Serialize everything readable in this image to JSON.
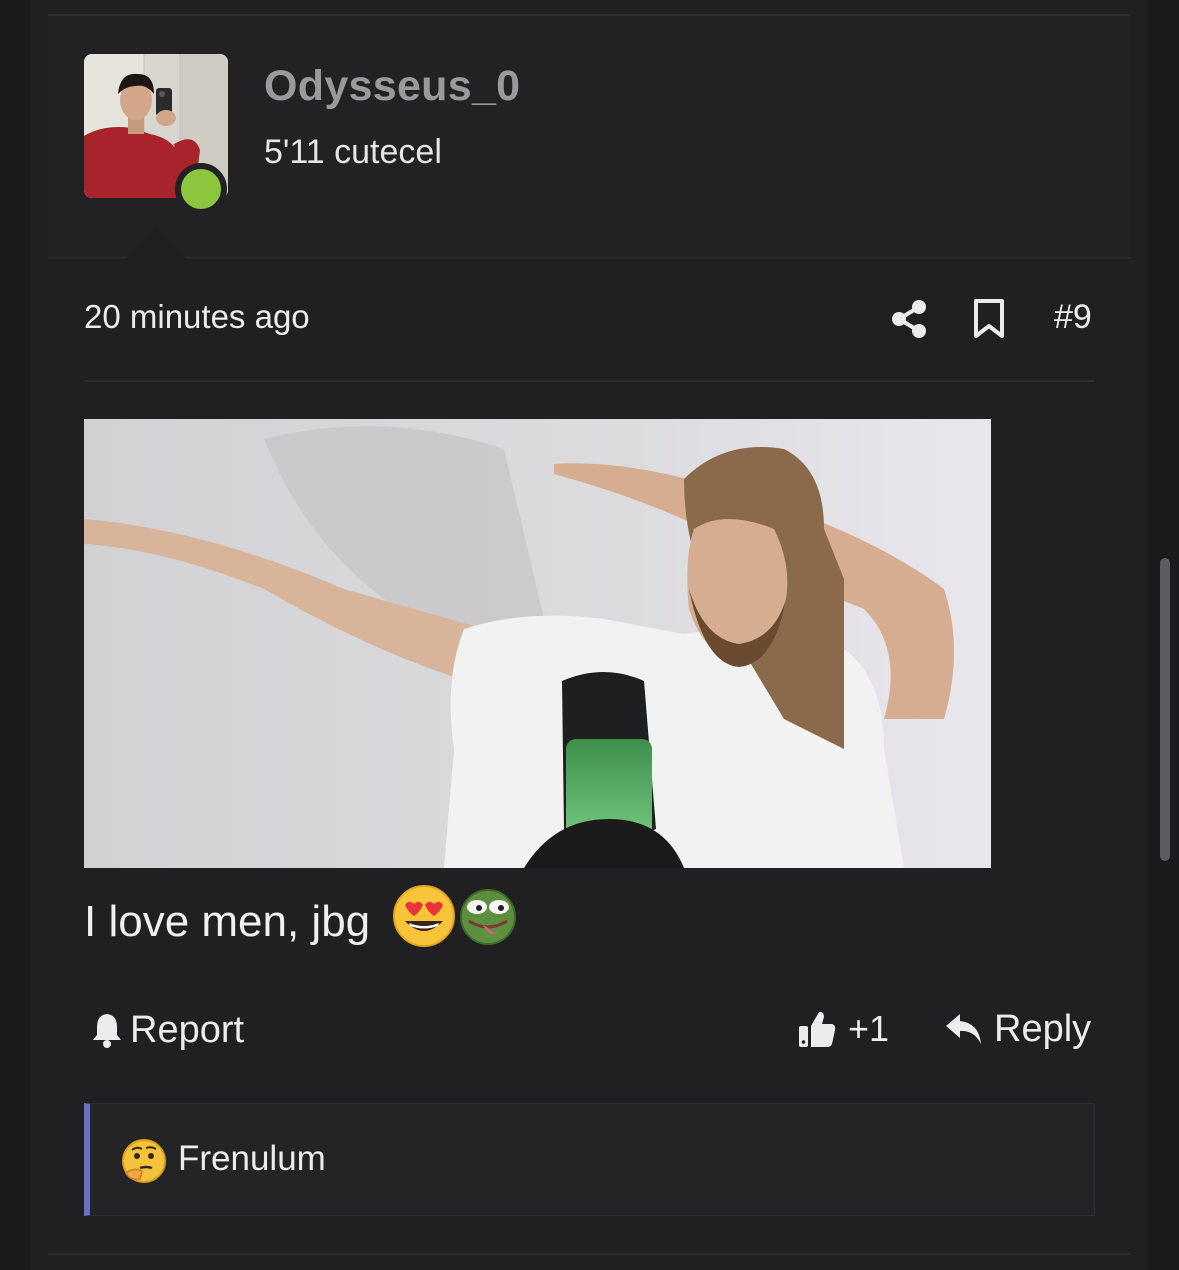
{
  "post": {
    "author": {
      "username": "Odysseus_0",
      "user_title": "5'11 cutecel",
      "online_status": "online",
      "online_color": "#8cc63f"
    },
    "meta": {
      "timestamp": "20 minutes ago",
      "post_number": "#9"
    },
    "body": {
      "text": "I love men, jbg",
      "emojis": [
        "star-struck-heart-eyes-emoji",
        "pepe-tongue-emoji"
      ]
    },
    "actions": {
      "report_label": "Report",
      "like_count": "+1",
      "reply_label": "Reply"
    },
    "reactions": {
      "user": "Frenulum",
      "emoji": "thinking-face-emoji",
      "accent_color": "#6a6fc7"
    }
  }
}
